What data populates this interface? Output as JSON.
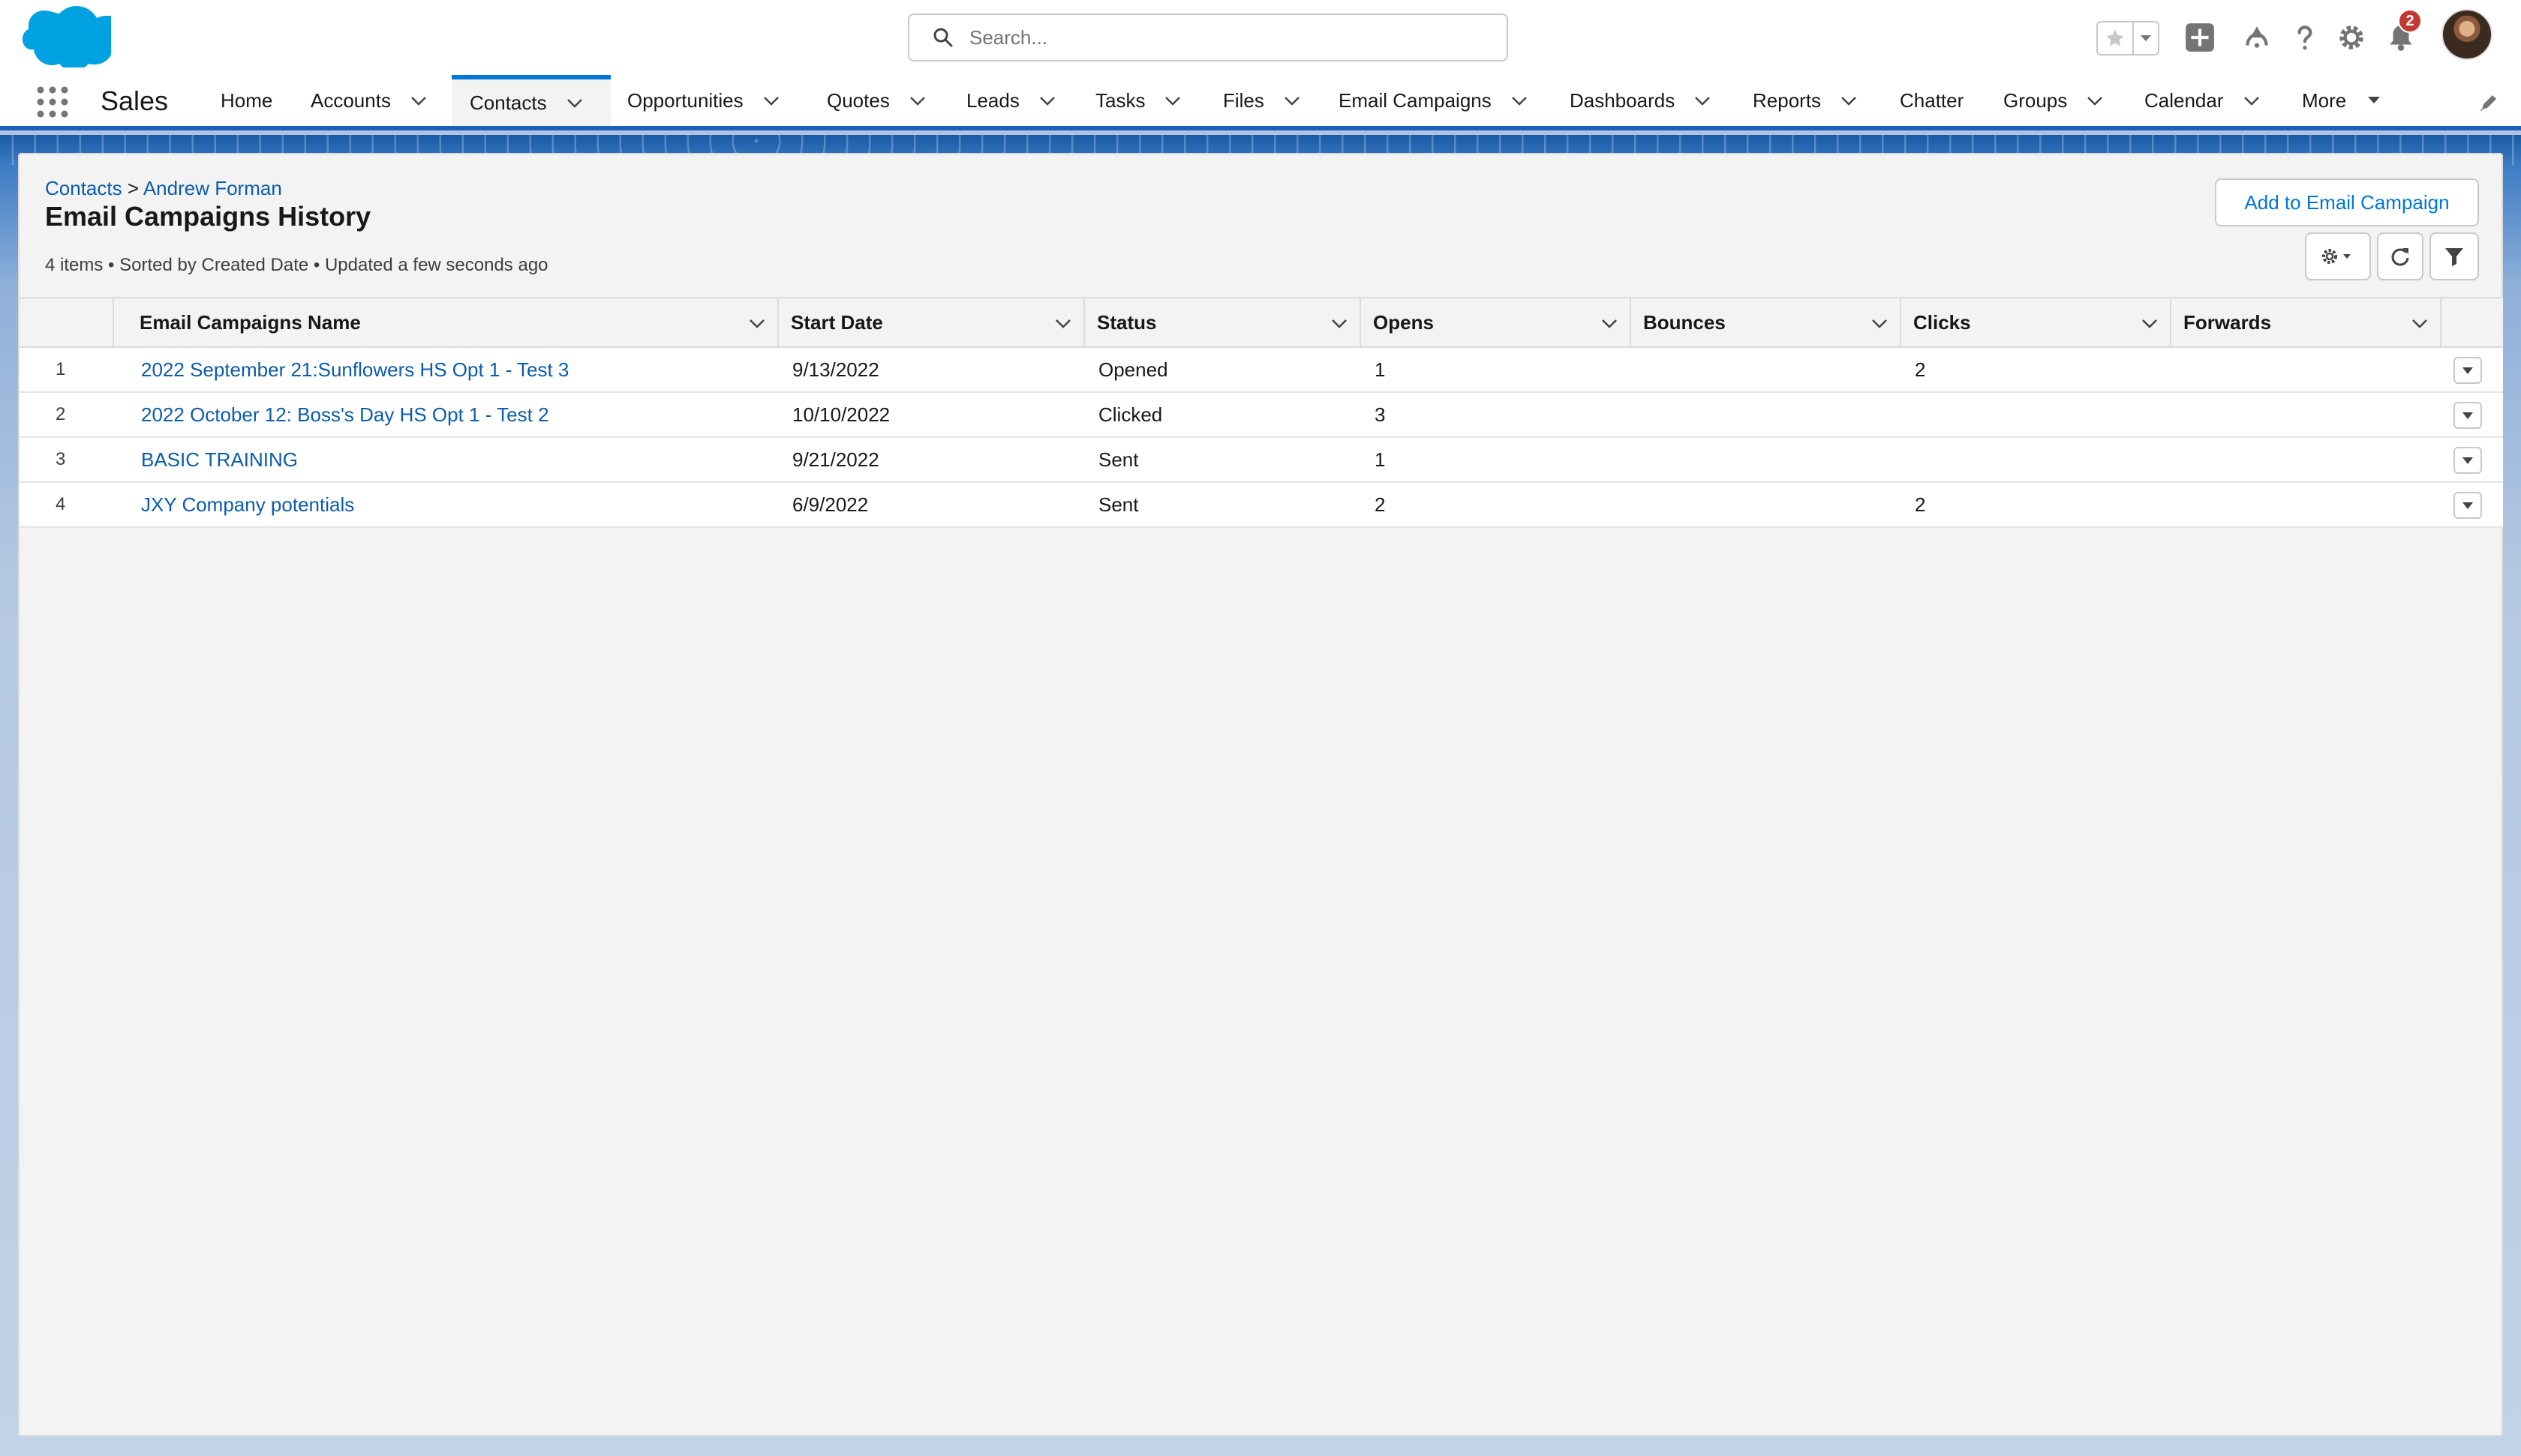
{
  "colors": {
    "brand_blue": "#0176d3",
    "link_blue": "#0b5cab",
    "nav_active_border": "#0176d3",
    "notification_red": "#c23934"
  },
  "header": {
    "search_placeholder": "Search...",
    "notification_count": "2",
    "icons": [
      "salesforce-cloud-logo",
      "search-icon",
      "star-icon",
      "chevron-down-icon",
      "add-icon",
      "trailhead-icon",
      "help-icon",
      "gear-icon",
      "bell-icon",
      "avatar"
    ]
  },
  "nav": {
    "app_name": "Sales",
    "items": [
      {
        "label": "Home",
        "has_menu": false
      },
      {
        "label": "Accounts",
        "has_menu": true
      },
      {
        "label": "Contacts",
        "has_menu": true,
        "active": true
      },
      {
        "label": "Opportunities",
        "has_menu": true
      },
      {
        "label": "Quotes",
        "has_menu": true
      },
      {
        "label": "Leads",
        "has_menu": true
      },
      {
        "label": "Tasks",
        "has_menu": true
      },
      {
        "label": "Files",
        "has_menu": true
      },
      {
        "label": "Email Campaigns",
        "has_menu": true
      },
      {
        "label": "Dashboards",
        "has_menu": true
      },
      {
        "label": "Reports",
        "has_menu": true
      },
      {
        "label": "Chatter",
        "has_menu": false
      },
      {
        "label": "Groups",
        "has_menu": true
      },
      {
        "label": "Calendar",
        "has_menu": true
      },
      {
        "label": "More",
        "has_menu": true
      }
    ]
  },
  "page": {
    "breadcrumb": {
      "root": "Contacts",
      "separator": ">",
      "record": "Andrew Forman"
    },
    "title": "Email Campaigns History",
    "list_info": "4 items • Sorted by Created Date • Updated a few seconds ago",
    "add_button_label": "Add to Email Campaign"
  },
  "table": {
    "columns": [
      "Email Campaigns Name",
      "Start Date",
      "Status",
      "Opens",
      "Bounces",
      "Clicks",
      "Forwards"
    ],
    "rows": [
      {
        "num": "1",
        "name": "2022 September 21:Sunflowers HS Opt 1 - Test 3",
        "start_date": "9/13/2022",
        "status": "Opened",
        "opens": "1",
        "bounces": "",
        "clicks": "2",
        "forwards": ""
      },
      {
        "num": "2",
        "name": "2022 October 12: Boss's Day HS Opt 1 - Test 2",
        "start_date": "10/10/2022",
        "status": "Clicked",
        "opens": "3",
        "bounces": "",
        "clicks": "",
        "forwards": ""
      },
      {
        "num": "3",
        "name": "BASIC TRAINING",
        "start_date": "9/21/2022",
        "status": "Sent",
        "opens": "1",
        "bounces": "",
        "clicks": "",
        "forwards": ""
      },
      {
        "num": "4",
        "name": "JXY Company potentials",
        "start_date": "6/9/2022",
        "status": "Sent",
        "opens": "2",
        "bounces": "",
        "clicks": "2",
        "forwards": ""
      }
    ]
  }
}
